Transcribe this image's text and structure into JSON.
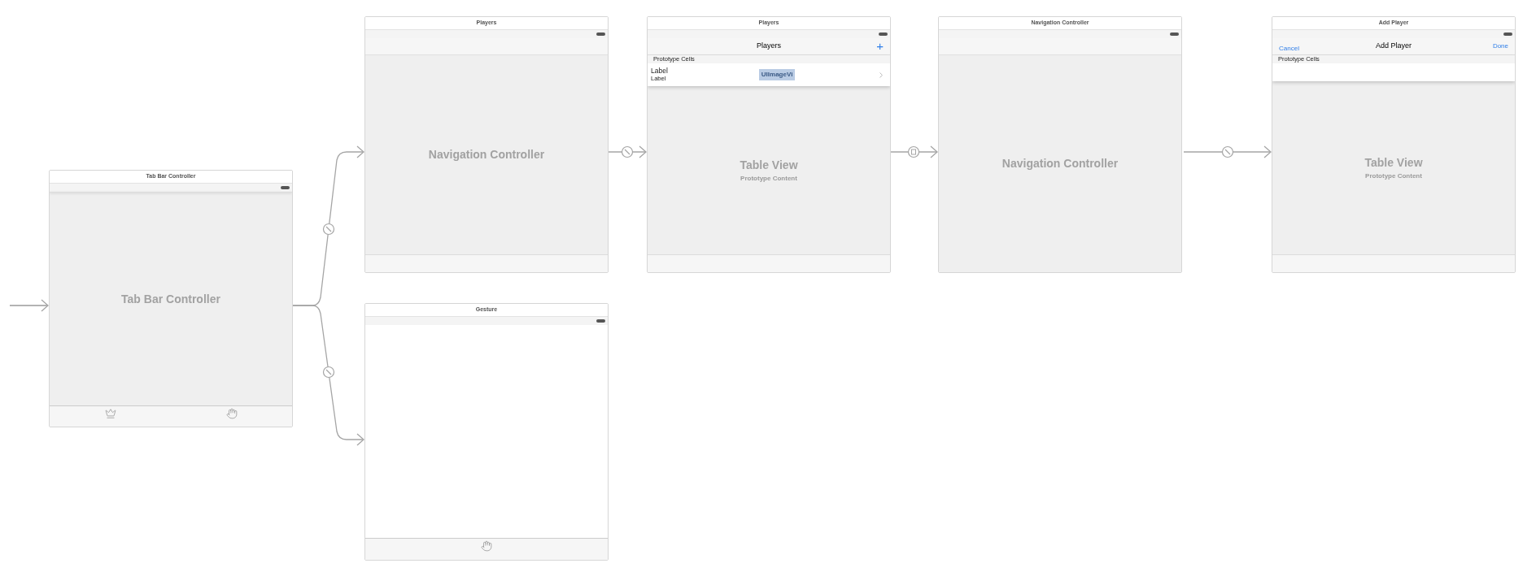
{
  "scenes": [
    {
      "kind": "tab_bar",
      "title": "Tab Bar Controller",
      "center_label": "Tab Bar Controller"
    },
    {
      "kind": "navigation",
      "title": "Players",
      "center_label": "Navigation Controller",
      "bottom_bar": true
    },
    {
      "kind": "plain",
      "title": "Gesture"
    },
    {
      "kind": "table",
      "title": "Players",
      "nav_title": "Players",
      "right_button": "+",
      "section_header": "Prototype Cells",
      "cell": {
        "title": "Label",
        "subtitle": "Label",
        "image_view": "UIImageVi"
      },
      "center_label": "Table View",
      "center_sublabel": "Prototype Content"
    },
    {
      "kind": "navigation",
      "title": "Navigation Controller",
      "center_label": "Navigation Controller",
      "bottom_bar": false
    },
    {
      "kind": "table",
      "title": "Add Player",
      "nav_title": "Add Player",
      "left_button": "Cancel",
      "right_button": "Done",
      "section_header": "Prototype Cells",
      "center_label": "Table View",
      "center_sublabel": "Prototype Content"
    }
  ],
  "segues": [
    {
      "kind": "initial"
    },
    {
      "kind": "relationship"
    },
    {
      "kind": "relationship"
    },
    {
      "kind": "relationship"
    },
    {
      "kind": "modal"
    },
    {
      "kind": "relationship"
    }
  ]
}
